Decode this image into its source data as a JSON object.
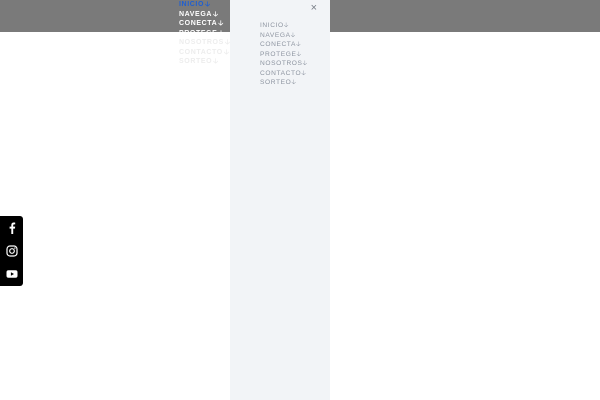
{
  "header": {
    "menu_items": [
      {
        "label": "INICIO",
        "arrow": "🡣",
        "state": "active"
      },
      {
        "label": "NAVEGA",
        "arrow": "🡣",
        "state": "normal"
      },
      {
        "label": "CONECTA",
        "arrow": "🡣",
        "state": "normal"
      },
      {
        "label": "PROTEGE",
        "arrow": "🡣",
        "state": "normal"
      },
      {
        "label": "NOSOTROS",
        "arrow": "🡣",
        "state": "faded"
      },
      {
        "label": "CONTACTO",
        "arrow": "🡣",
        "state": "faded"
      },
      {
        "label": "SORTEO",
        "arrow": "🡣",
        "state": "faded"
      }
    ]
  },
  "drawer": {
    "close_symbol": "×",
    "menu_items": [
      {
        "label": "INICIO",
        "arrow": "🡣"
      },
      {
        "label": "NAVEGA",
        "arrow": "🡣"
      },
      {
        "label": "CONECTA",
        "arrow": "🡣"
      },
      {
        "label": "PROTEGE",
        "arrow": "🡣"
      },
      {
        "label": "NOSOTROS",
        "arrow": "🡣"
      },
      {
        "label": "CONTACTO",
        "arrow": "🡣"
      },
      {
        "label": "SORTEO",
        "arrow": "🡣"
      }
    ]
  },
  "social": {
    "icons": [
      "facebook-icon",
      "instagram-icon",
      "youtube-icon"
    ]
  },
  "colors": {
    "topbar": "#7a7a7a",
    "active_link": "#1f5fd1",
    "drawer_bg": "#f2f4f7",
    "drawer_text": "#8d94a0",
    "social_bar": "#000000"
  }
}
